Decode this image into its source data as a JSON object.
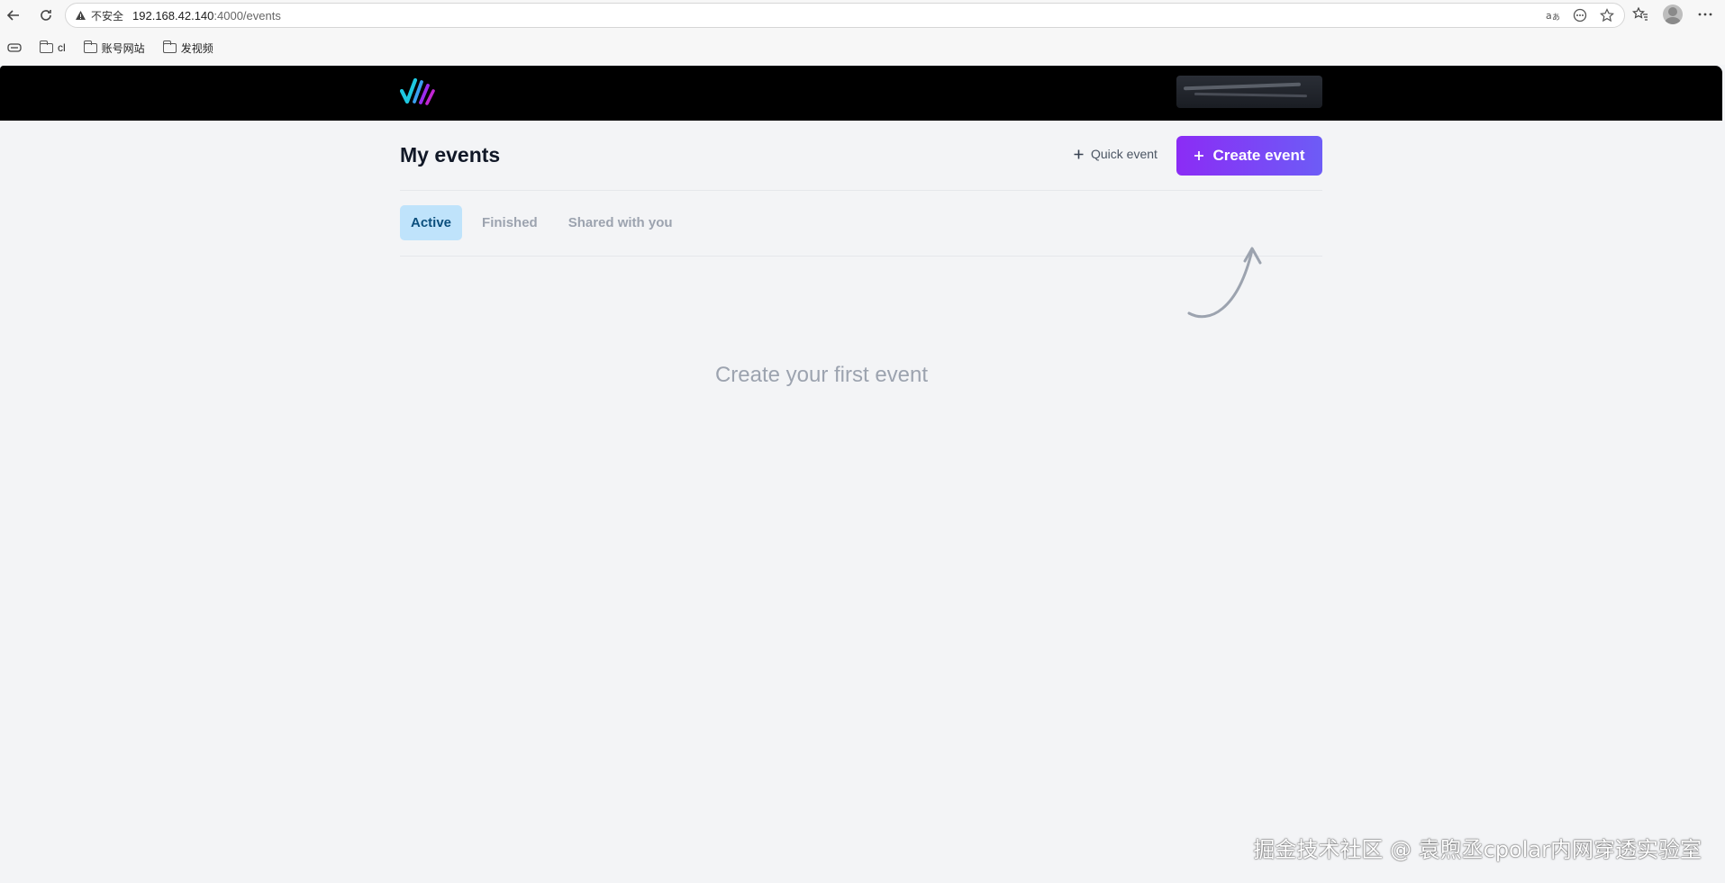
{
  "browser": {
    "security_label": "不安全",
    "url_host": "192.168.42.140",
    "url_path": ":4000/events",
    "bookmarks": [
      {
        "label": "cl"
      },
      {
        "label": "账号网站"
      },
      {
        "label": "发视频"
      }
    ]
  },
  "header": {
    "brand_colors": [
      "#1ec8e0",
      "#9b2cf0",
      "#c026d3"
    ]
  },
  "main": {
    "title": "My events",
    "quick_event_label": "Quick event",
    "create_event_label": "Create event",
    "tabs": [
      {
        "label": "Active",
        "active": true
      },
      {
        "label": "Finished",
        "active": false
      },
      {
        "label": "Shared with you",
        "active": false
      }
    ],
    "empty_state": "Create your first event"
  },
  "watermark": "掘金技术社区 @ 袁煦丞cpolar内网穿透实验室",
  "colors": {
    "accent_start": "#8b2cf5",
    "accent_end": "#6d5cf6",
    "tab_active_bg": "#bfe3fb",
    "tab_active_text": "#0b4f7d"
  }
}
